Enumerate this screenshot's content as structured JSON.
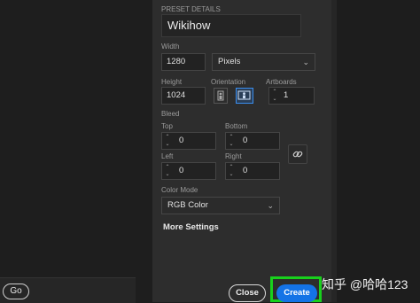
{
  "left": {
    "go_label": "Go"
  },
  "panel": {
    "section_title": "PRESET DETAILS",
    "preset_name": "Wikihow",
    "width_label": "Width",
    "width_value": "1280",
    "units_value": "Pixels",
    "height_label": "Height",
    "height_value": "1024",
    "orientation_label": "Orientation",
    "artboards_label": "Artboards",
    "artboards_value": "1",
    "bleed_label": "Bleed",
    "top_label": "Top",
    "top_value": "0",
    "bottom_label": "Bottom",
    "bottom_value": "0",
    "left_label": "Left",
    "left_value": "0",
    "right_label": "Right",
    "right_value": "0",
    "color_mode_label": "Color Mode",
    "color_mode_value": "RGB Color",
    "more_settings_label": "More Settings"
  },
  "buttons": {
    "close_label": "Close",
    "create_label": "Create"
  },
  "watermark": "知乎 @哈哈123",
  "colors": {
    "accent": "#1473e6",
    "highlight": "#18d11c",
    "panel_bg": "#2d2d2d"
  }
}
